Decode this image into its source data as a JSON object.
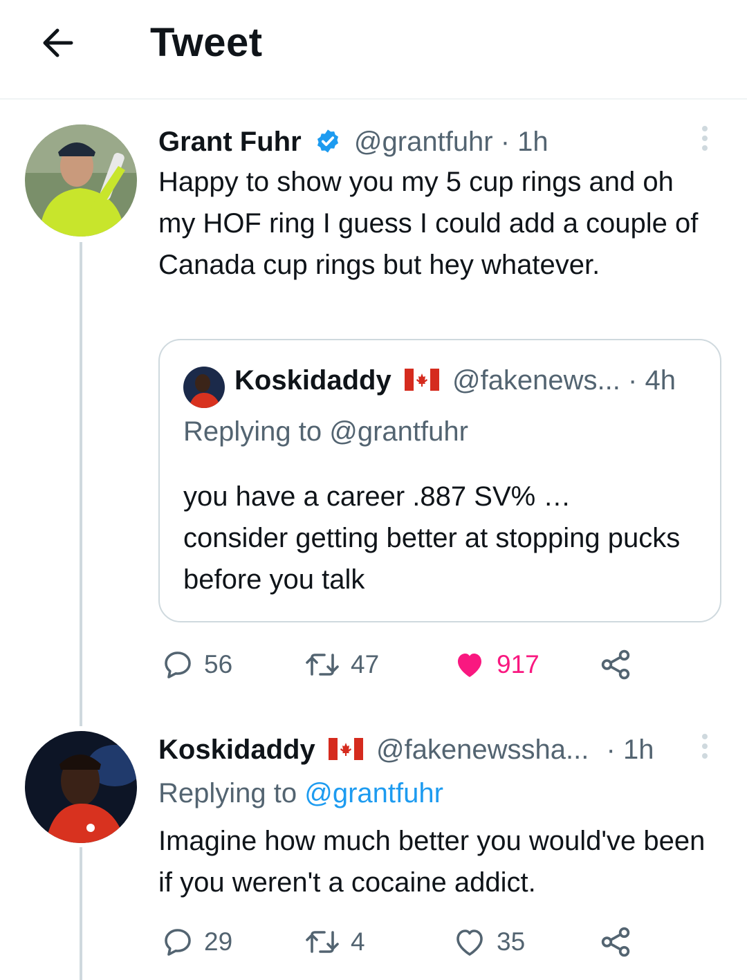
{
  "header": {
    "title": "Tweet"
  },
  "main_tweet": {
    "name": "Grant Fuhr",
    "handle": "@grantfuhr",
    "time": "· 1h",
    "text": "Happy to show you my 5 cup rings and oh my HOF ring I guess I could add a couple of Canada cup rings but hey whatever.",
    "verified": true,
    "quote": {
      "name": "Koskidaddy",
      "handle": "@fakenews...",
      "time": "· 4h",
      "replying": "Replying to @grantfuhr",
      "text": "you have a career .887 SV% … consider getting better at stopping pucks before you talk"
    },
    "actions": {
      "replies": "56",
      "retweets": "47",
      "likes": "917",
      "liked": true
    }
  },
  "reply_tweet": {
    "name": "Koskidaddy",
    "handle": "@fakenewssha...",
    "time": "· 1h",
    "replying_prefix": "Replying to",
    "replying_handle": "@grantfuhr",
    "text": "Imagine how much better you would've been if you weren't a cocaine addict.",
    "actions": {
      "replies": "29",
      "retweets": "4",
      "likes": "35",
      "liked": false
    }
  },
  "colors": {
    "accent": "#1d9bf0",
    "like": "#f91880",
    "muted": "#536471",
    "border": "#cfd9de"
  },
  "icons": [
    "back-arrow-icon",
    "verified-badge-icon",
    "canada-flag-icon",
    "reply-icon",
    "retweet-icon",
    "heart-icon",
    "share-icon",
    "more-icon"
  ]
}
